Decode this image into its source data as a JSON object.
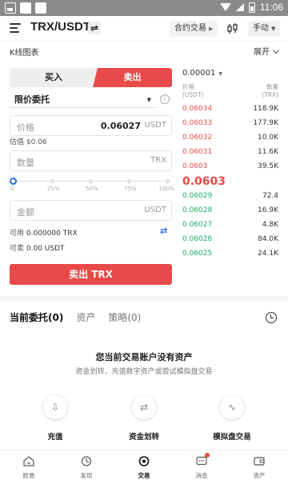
{
  "status_bar": {
    "time": "11:06"
  },
  "header": {
    "pair": "TRX/USDT",
    "swap_glyph": "⇌",
    "contract_label": "合约交易",
    "manual_label": "手动"
  },
  "kline": {
    "label": "K线图表",
    "expand_label": "展开"
  },
  "trade": {
    "buy_tab": "买入",
    "sell_tab": "卖出",
    "order_type": "限价委托",
    "price_label": "价格",
    "price_value": "0.06027",
    "price_unit": "USDT",
    "estimate": "估值 $0.06",
    "amount_label": "数量",
    "amount_unit": "TRX",
    "slider_marks": [
      "0",
      "25%",
      "50%",
      "75%",
      "100%"
    ],
    "slider_value_percent": 0,
    "total_label": "金额",
    "total_unit": "USDT",
    "available_label": "可用",
    "available_value": "0.000000 TRX",
    "sellable_label": "可卖",
    "sellable_value": "0.00 USDT",
    "submit_label": "卖出 TRX"
  },
  "order_book": {
    "precision": "0.00001",
    "price_header": "价格",
    "price_header_unit": "(USDT)",
    "qty_header": "数量",
    "qty_header_unit": "(TRX)",
    "asks": [
      {
        "price": "0.06034",
        "qty": "118.9K"
      },
      {
        "price": "0.06033",
        "qty": "177.9K"
      },
      {
        "price": "0.06032",
        "qty": "10.0K"
      },
      {
        "price": "0.06031",
        "qty": "11.6K"
      },
      {
        "price": "0.0603",
        "qty": "39.5K"
      }
    ],
    "last_price": "0.0603",
    "bids": [
      {
        "price": "0.06029",
        "qty": "72.4"
      },
      {
        "price": "0.06028",
        "qty": "16.9K"
      },
      {
        "price": "0.06027",
        "qty": "4.8K"
      },
      {
        "price": "0.06026",
        "qty": "84.0K"
      },
      {
        "price": "0.06025",
        "qty": "24.1K"
      }
    ]
  },
  "orders_section": {
    "tabs": [
      "当前委托(0)",
      "资产",
      "策略(0)"
    ],
    "empty_title": "您当前交易账户没有资产",
    "empty_subtitle": "资金划转，充值数字资产或尝试模拟盘交易",
    "actions": [
      {
        "label": "充值",
        "icon": "deposit-icon",
        "glyph": "⇩"
      },
      {
        "label": "资金划转",
        "icon": "transfer-icon",
        "glyph": "⇄"
      },
      {
        "label": "模拟盘交易",
        "icon": "demo-trading-icon",
        "glyph": "∿"
      }
    ]
  },
  "bottom_nav": [
    {
      "label": "欧易",
      "icon": "home-icon"
    },
    {
      "label": "发现",
      "icon": "discover-icon"
    },
    {
      "label": "交易",
      "icon": "trade-icon"
    },
    {
      "label": "消息",
      "icon": "message-icon"
    },
    {
      "label": "资产",
      "icon": "wallet-icon"
    }
  ],
  "colors": {
    "sell": "#e84a49",
    "buy": "#1eaa6a",
    "accent": "#2a6ae0"
  }
}
